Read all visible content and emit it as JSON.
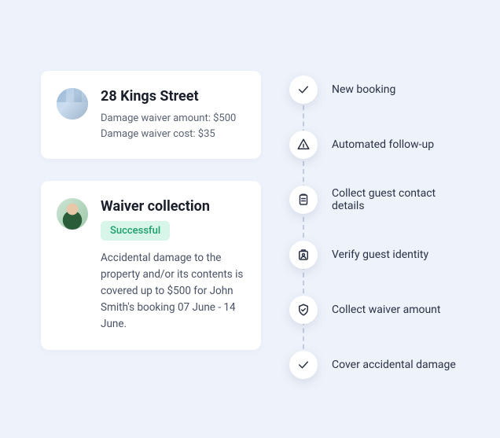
{
  "property": {
    "title": "28 Kings Street",
    "waiver_amount_label": "Damage waiver amount: $500",
    "waiver_cost_label": "Damage waiver cost: $35"
  },
  "waiver": {
    "title": "Waiver collection",
    "status_badge": "Successful",
    "description": "Accidental damage to the property and/or its contents is covered up to $500 for John Smith's booking 07 June - 14 June."
  },
  "timeline": {
    "steps": [
      {
        "label": "New booking",
        "icon": "check"
      },
      {
        "label": "Automated follow-up",
        "icon": "send"
      },
      {
        "label": "Collect guest contact details",
        "icon": "clipboard"
      },
      {
        "label": "Verify guest identity",
        "icon": "id"
      },
      {
        "label": "Collect waiver amount",
        "icon": "shield"
      },
      {
        "label": "Cover accidental damage",
        "icon": "check"
      }
    ]
  }
}
